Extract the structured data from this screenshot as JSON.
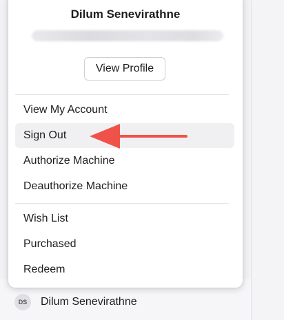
{
  "account_menu": {
    "user_name": "Dilum Senevirathne",
    "view_profile_label": "View Profile",
    "items": [
      {
        "label": "View My Account"
      },
      {
        "label": "Sign Out"
      },
      {
        "label": "Authorize Machine"
      },
      {
        "label": "Deauthorize Machine"
      },
      {
        "label": "Wish List"
      },
      {
        "label": "Purchased"
      },
      {
        "label": "Redeem"
      }
    ]
  },
  "footer": {
    "avatar_initials": "DS",
    "user_name": "Dilum Senevirathne"
  },
  "annotation": {
    "arrow_color": "#f0524a",
    "icon": "left-arrow-icon"
  }
}
